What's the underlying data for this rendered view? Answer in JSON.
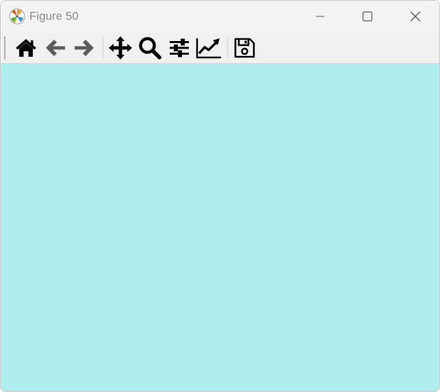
{
  "window": {
    "title": "Figure 50",
    "app_icon": "matplotlib-logo"
  },
  "controls": {
    "minimize_icon": "minimize-icon",
    "maximize_icon": "maximize-icon",
    "close_icon": "close-icon"
  },
  "toolbar": {
    "tools": [
      {
        "icon": "home-icon",
        "enabled": true
      },
      {
        "icon": "back-arrow-icon",
        "enabled": false
      },
      {
        "icon": "forward-arrow-icon",
        "enabled": false
      },
      {
        "icon": "pan-icon",
        "enabled": true
      },
      {
        "icon": "zoom-icon",
        "enabled": true
      },
      {
        "icon": "subplots-config-icon",
        "enabled": true
      },
      {
        "icon": "edit-axis-icon",
        "enabled": true
      },
      {
        "icon": "save-icon",
        "enabled": true
      }
    ]
  },
  "figure": {
    "background_color": "#afedee"
  },
  "colors": {
    "titlebar_bg": "#f3f3f3",
    "toolbar_bg": "#f0f0f0",
    "icon_active": "#000000",
    "icon_disabled": "#5c5c5c",
    "title_text": "#8a8a8a"
  }
}
